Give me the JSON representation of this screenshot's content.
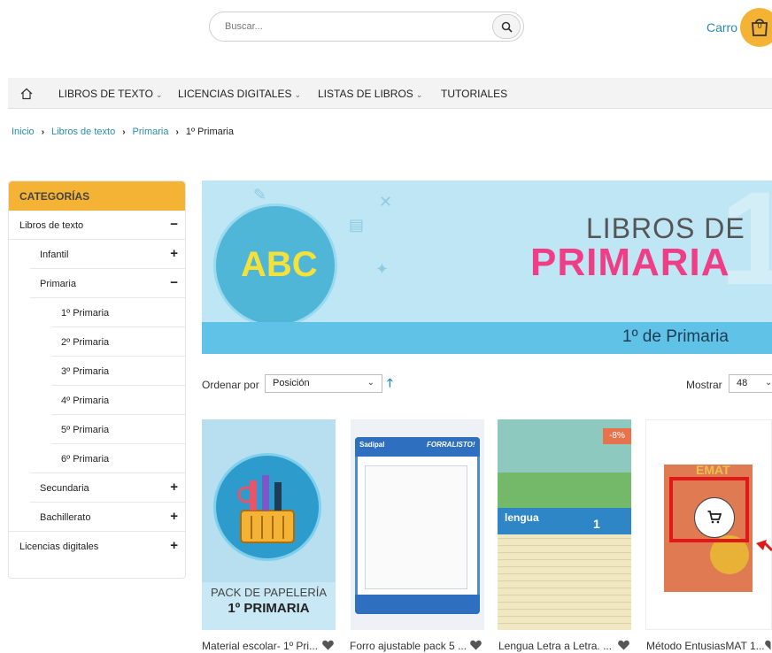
{
  "header": {
    "search_placeholder": "Buscar...",
    "cart_label": "Carro",
    "cart_count": "0"
  },
  "nav": {
    "items": [
      {
        "label": "LIBROS DE TEXTO"
      },
      {
        "label": "LICENCIAS DIGITALES"
      },
      {
        "label": "LISTAS DE LIBROS"
      },
      {
        "label": "TUTORIALES"
      }
    ]
  },
  "breadcrumb": [
    "Inicio",
    "Libros de texto",
    "Primaria",
    "1º Primaria"
  ],
  "sidebar": {
    "title": "CATEGORÍAS",
    "items": [
      {
        "label": "Libros de texto",
        "sign": "−"
      },
      {
        "label": "Infantil",
        "sign": "+"
      },
      {
        "label": "Primaria",
        "sign": "−"
      },
      {
        "label": "1º Primaria",
        "sign": ""
      },
      {
        "label": "2º Primaria",
        "sign": ""
      },
      {
        "label": "3º Primaria",
        "sign": ""
      },
      {
        "label": "4º Primaria",
        "sign": ""
      },
      {
        "label": "5º Primaria",
        "sign": ""
      },
      {
        "label": "6º Primaria",
        "sign": ""
      },
      {
        "label": "Secundaria",
        "sign": "+"
      },
      {
        "label": "Bachillerato",
        "sign": "+"
      },
      {
        "label": "Licencias digitales",
        "sign": "+"
      }
    ]
  },
  "banner": {
    "line1": "LIBROS DE",
    "line2": "PRIMARIA",
    "subtitle": "1º de Primaria",
    "logo_text": "ABC",
    "big_digit": "1"
  },
  "toolbar": {
    "sort_label": "Ordenar por",
    "sort_value": "Posición",
    "show_label": "Mostrar",
    "show_value": "48"
  },
  "products": [
    {
      "name": "Material escolar- 1º Pri...",
      "image_text_1": "PACK DE PAPELERÍA",
      "image_text_2": "1º PRIMARIA"
    },
    {
      "name": "Forro ajustable pack 5 ...",
      "image_text_1": "Sadipal",
      "image_text_2": "FORRALISTO!"
    },
    {
      "name": "Lengua Letra a Letra. ...",
      "image_text_1": "lengua",
      "image_text_2": "1",
      "badge": "-8%"
    },
    {
      "name": "Método EntusiasMAT 1...",
      "image_text_1": "EMAT"
    }
  ],
  "colors": {
    "accent_orange": "#f5b335",
    "link_blue": "#2b8ab0",
    "pink": "#ef3e86",
    "highlight_red": "#e01818"
  }
}
